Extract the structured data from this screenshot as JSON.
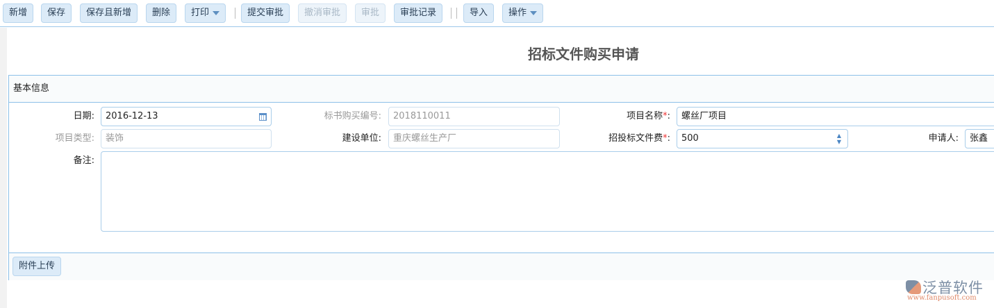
{
  "toolbar": {
    "new": "新增",
    "save": "保存",
    "save_new": "保存且新增",
    "delete": "删除",
    "print": "打印",
    "submit": "提交审批",
    "revoke": "撤消审批",
    "approve": "审批",
    "approval_log": "审批记录",
    "import": "导入",
    "operate": "操作"
  },
  "page_title": "招标文件购买申请",
  "section": {
    "title": "基本信息"
  },
  "form": {
    "date": {
      "label": "日期:",
      "value": "2016-12-13"
    },
    "doc_no": {
      "label": "标书购买编号:",
      "value": "2018110011"
    },
    "project_name": {
      "label": "项目名称",
      "value": "螺丝厂项目"
    },
    "project_type": {
      "label": "项目类型:",
      "value": "装饰"
    },
    "builder": {
      "label": "建设单位:",
      "value": "重庆螺丝生产厂"
    },
    "fee": {
      "label": "招投标文件费",
      "value": "500"
    },
    "applicant": {
      "label": "申请人:",
      "value": "张鑫"
    },
    "remark": {
      "label": "备注:",
      "value": ""
    },
    "required_mark": "*",
    "colon": ":"
  },
  "attachment": {
    "upload": "附件上传"
  },
  "logo": {
    "name": "泛普软件",
    "url": "www.fanpusoft.com"
  }
}
